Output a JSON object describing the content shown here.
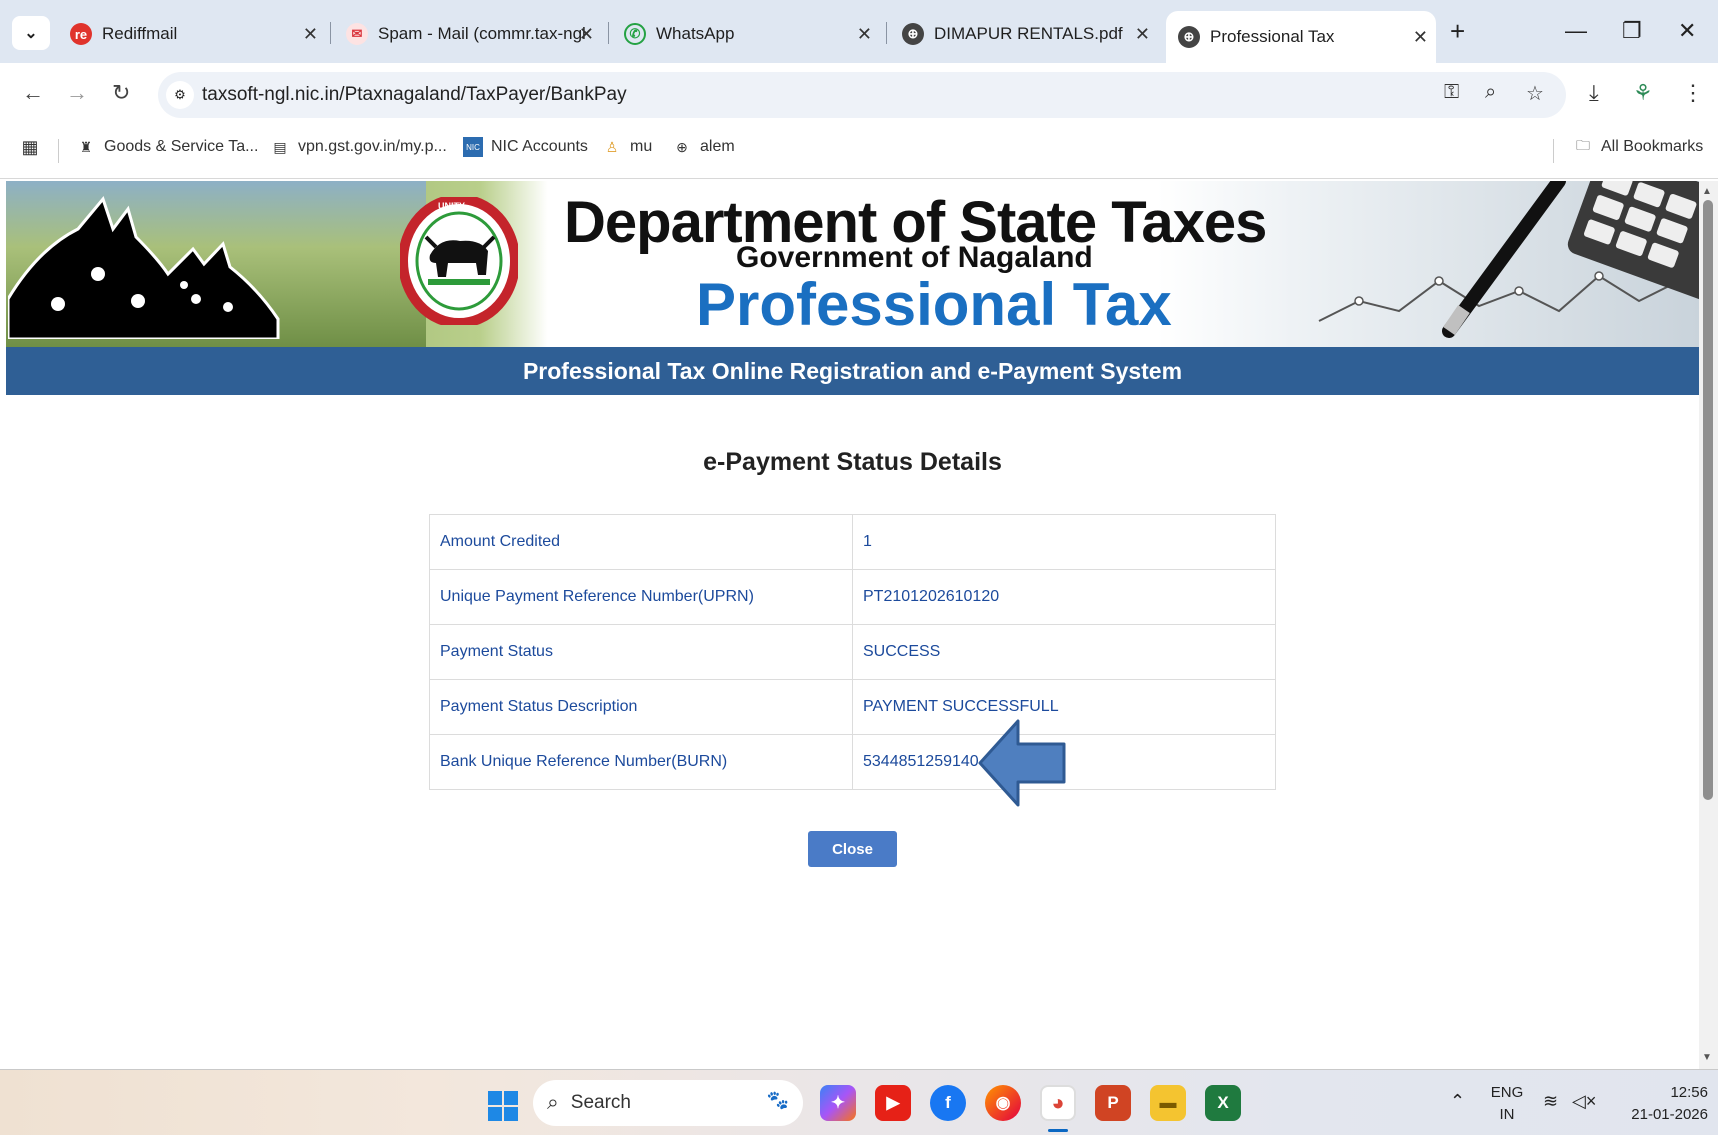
{
  "browser": {
    "tabs": [
      {
        "title": "Rediffmail",
        "icon": "rediffmail-icon",
        "color": "#e0332c",
        "glyph": "re"
      },
      {
        "title": "Spam - Mail (commr.tax-ngl",
        "icon": "mail-icon",
        "color": "#d9363e",
        "glyph": "✉"
      },
      {
        "title": "WhatsApp",
        "icon": "whatsapp-icon",
        "color": "#25a244",
        "glyph": "✆"
      },
      {
        "title": "DIMAPUR RENTALS.pdf",
        "icon": "globe-icon",
        "color": "#444444",
        "glyph": "⊕"
      },
      {
        "title": "Professional Tax",
        "icon": "globe-icon",
        "color": "#444444",
        "glyph": "⊕",
        "active": true
      }
    ],
    "url": "taxsoft-ngl.nic.in/Ptaxnagaland/TaxPayer/BankPay",
    "bookmarks": [
      {
        "label": "Goods & Service Ta...",
        "icon": "emblem-icon"
      },
      {
        "label": "vpn.gst.gov.in/my.p...",
        "icon": "document-icon"
      },
      {
        "label": "NIC Accounts",
        "icon": "nic-icon"
      },
      {
        "label": "mu",
        "icon": "person-icon"
      },
      {
        "label": "alem",
        "icon": "globe-icon"
      }
    ],
    "all_bookmarks": "All Bookmarks"
  },
  "banner": {
    "title": "Department of State Taxes",
    "subtitle": "Government of Nagaland",
    "product": "Professional Tax",
    "emblem_text": "UNITY",
    "emblem_ring_text": "GOVERNMENT OF NAGALAND"
  },
  "header_bar": "Professional Tax Online Registration and e-Payment System",
  "page": {
    "heading": "e-Payment Status Details",
    "rows": [
      {
        "label": "Amount Credited",
        "value": "1"
      },
      {
        "label": "Unique Payment Reference Number(UPRN)",
        "value": "PT2101202610120"
      },
      {
        "label": "Payment Status",
        "value": "SUCCESS"
      },
      {
        "label": "Payment Status Description",
        "value": "PAYMENT SUCCESSFULL"
      },
      {
        "label": "Bank Unique Reference Number(BURN)",
        "value": "5344851259140"
      }
    ],
    "close_label": "Close"
  },
  "taskbar": {
    "search_placeholder": "Search",
    "lang_top": "ENG",
    "lang_bottom": "IN",
    "time": "12:56",
    "date": "21-01-2026"
  },
  "colors": {
    "header_bar": "#2f5f95",
    "label_text": "#1c4a9c",
    "close_button": "#4a7bc7",
    "product_title": "#1a6fc1",
    "pointer_arrow": "#4f7fbf"
  }
}
